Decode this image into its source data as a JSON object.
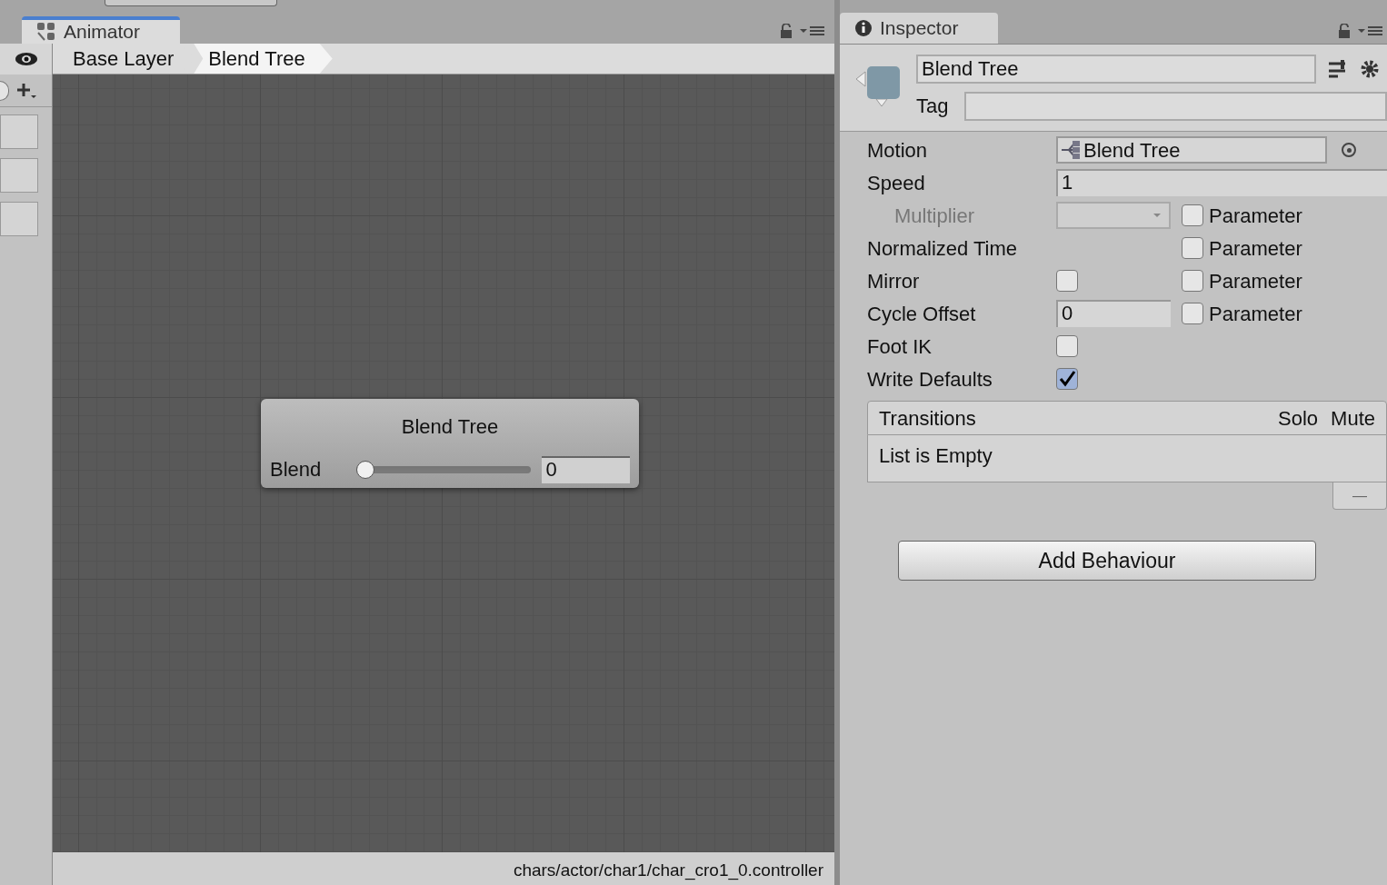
{
  "animator": {
    "tab": {
      "title": "Animator",
      "selected": true
    },
    "breadcrumbs": [
      {
        "label": "Base Layer",
        "selected": false
      },
      {
        "label": "Blend Tree",
        "selected": true
      }
    ],
    "node": {
      "title": "Blend Tree",
      "parameter": {
        "label": "Blend",
        "level": 0,
        "value": "0"
      }
    },
    "status_bar": "chars/actor/char1/char_cro1_0.controller"
  },
  "inspector": {
    "tab": {
      "title": "Inspector",
      "selected": false
    },
    "header": {
      "name": "Blend Tree",
      "tag_label": "Tag"
    },
    "properties": [
      {
        "kind": "object",
        "label": "Motion",
        "value": "Blend Tree",
        "disabled": false
      },
      {
        "kind": "number",
        "label": "Speed",
        "value": "1",
        "disabled": false
      },
      {
        "kind": "dropdown",
        "label": "Multiplier",
        "disabled": true,
        "parameter": {
          "label": "Parameter",
          "checked": false
        }
      },
      {
        "kind": "none",
        "label": "Normalized Time",
        "disabled": false,
        "parameter": {
          "label": "Parameter",
          "checked": false
        }
      },
      {
        "kind": "checkbox",
        "label": "Mirror",
        "checked": false,
        "disabled": false,
        "parameter": {
          "label": "Parameter",
          "checked": false
        }
      },
      {
        "kind": "short_number",
        "label": "Cycle Offset",
        "value": "0",
        "disabled": false,
        "parameter": {
          "label": "Parameter",
          "checked": false
        }
      },
      {
        "kind": "checkbox",
        "label": "Foot IK",
        "checked": false,
        "disabled": false
      },
      {
        "kind": "checkbox",
        "label": "Write Defaults",
        "checked": true,
        "disabled": false
      }
    ],
    "transitions": {
      "title": "Transitions",
      "columns": [
        "Solo",
        "Mute"
      ],
      "empty_text": "List is Empty",
      "remove_symbol": "—"
    },
    "add_button": "Add Behaviour"
  }
}
